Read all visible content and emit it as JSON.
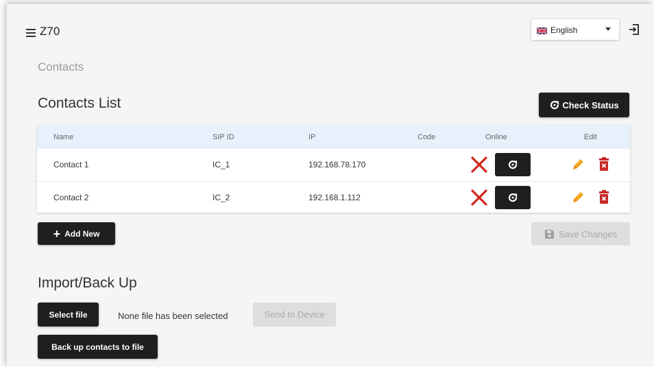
{
  "app": {
    "title": "Z70"
  },
  "language": {
    "selected": "English"
  },
  "breadcrumb": "Contacts",
  "contacts": {
    "section_title": "Contacts List",
    "check_status_label": "Check Status",
    "columns": [
      "Name",
      "SIP ID",
      "IP",
      "Code",
      "Online",
      "Edit"
    ],
    "rows": [
      {
        "name": "Contact 1",
        "sip_id": "IC_1",
        "ip": "192.168.78.170",
        "code": "",
        "online": false
      },
      {
        "name": "Contact 2",
        "sip_id": "IC_2",
        "ip": "192.168.1.112",
        "code": "",
        "online": false
      }
    ],
    "add_new_label": "Add New",
    "save_changes_label": "Save Changes"
  },
  "import_backup": {
    "section_title": "Import/Back Up",
    "select_file_label": "Select file",
    "file_status": "None file has been selected",
    "send_to_device_label": "Send to Device",
    "backup_label": "Back up contacts to file"
  },
  "colors": {
    "offline": "#d0271e",
    "edit": "#f5a623",
    "delete": "#c62828",
    "dark_button": "#1f1f1f",
    "table_header": "#e6f1fb"
  }
}
